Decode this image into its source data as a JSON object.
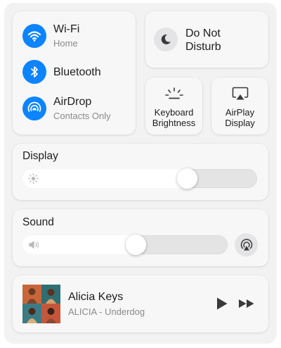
{
  "connectivity": {
    "wifi": {
      "title": "Wi-Fi",
      "subtitle": "Home",
      "icon": "wifi-icon"
    },
    "bluetooth": {
      "title": "Bluetooth",
      "icon": "bluetooth-icon"
    },
    "airdrop": {
      "title": "AirDrop",
      "subtitle": "Contacts Only",
      "icon": "airdrop-icon"
    }
  },
  "do_not_disturb": {
    "label_line1": "Do Not",
    "label_line2": "Disturb",
    "icon": "moon-icon"
  },
  "keyboard_brightness": {
    "line1": "Keyboard",
    "line2": "Brightness",
    "icon": "keyboard-brightness-icon"
  },
  "airplay_display": {
    "line1": "AirPlay",
    "line2": "Display",
    "icon": "airplay-display-icon"
  },
  "display": {
    "label": "Display",
    "level": 0.7,
    "icon": "sun-icon"
  },
  "sound": {
    "label": "Sound",
    "level": 0.55,
    "icon": "speaker-icon",
    "output_icon": "airplay-audio-icon"
  },
  "now_playing": {
    "artist": "Alicia Keys",
    "album_track": "ALICIA - Underdog",
    "controls": [
      "play-icon",
      "fast-forward-icon"
    ]
  },
  "colors": {
    "accent": "#0a84ff",
    "panel": "#f2f2f2",
    "tile": "#f7f7f7"
  }
}
